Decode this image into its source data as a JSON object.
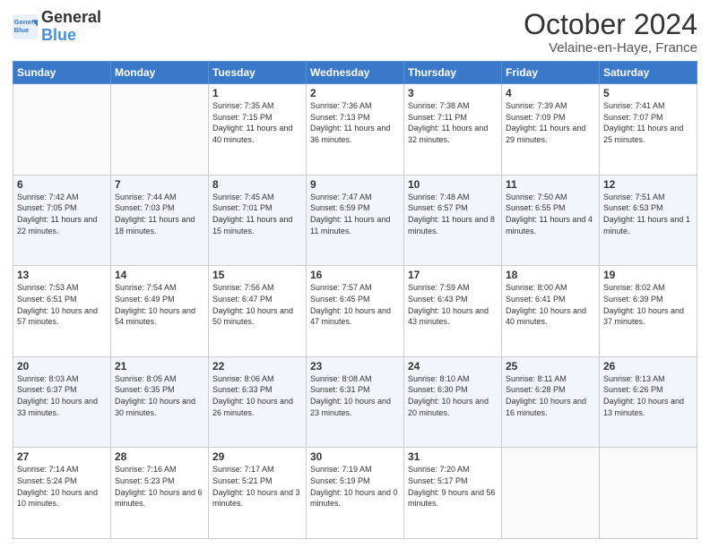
{
  "logo": {
    "line1": "General",
    "line2": "Blue"
  },
  "title": "October 2024",
  "location": "Velaine-en-Haye, France",
  "days_of_week": [
    "Sunday",
    "Monday",
    "Tuesday",
    "Wednesday",
    "Thursday",
    "Friday",
    "Saturday"
  ],
  "weeks": [
    [
      {
        "day": "",
        "info": ""
      },
      {
        "day": "",
        "info": ""
      },
      {
        "day": "1",
        "info": "Sunrise: 7:35 AM\nSunset: 7:15 PM\nDaylight: 11 hours and 40 minutes."
      },
      {
        "day": "2",
        "info": "Sunrise: 7:36 AM\nSunset: 7:13 PM\nDaylight: 11 hours and 36 minutes."
      },
      {
        "day": "3",
        "info": "Sunrise: 7:38 AM\nSunset: 7:11 PM\nDaylight: 11 hours and 32 minutes."
      },
      {
        "day": "4",
        "info": "Sunrise: 7:39 AM\nSunset: 7:09 PM\nDaylight: 11 hours and 29 minutes."
      },
      {
        "day": "5",
        "info": "Sunrise: 7:41 AM\nSunset: 7:07 PM\nDaylight: 11 hours and 25 minutes."
      }
    ],
    [
      {
        "day": "6",
        "info": "Sunrise: 7:42 AM\nSunset: 7:05 PM\nDaylight: 11 hours and 22 minutes."
      },
      {
        "day": "7",
        "info": "Sunrise: 7:44 AM\nSunset: 7:03 PM\nDaylight: 11 hours and 18 minutes."
      },
      {
        "day": "8",
        "info": "Sunrise: 7:45 AM\nSunset: 7:01 PM\nDaylight: 11 hours and 15 minutes."
      },
      {
        "day": "9",
        "info": "Sunrise: 7:47 AM\nSunset: 6:59 PM\nDaylight: 11 hours and 11 minutes."
      },
      {
        "day": "10",
        "info": "Sunrise: 7:48 AM\nSunset: 6:57 PM\nDaylight: 11 hours and 8 minutes."
      },
      {
        "day": "11",
        "info": "Sunrise: 7:50 AM\nSunset: 6:55 PM\nDaylight: 11 hours and 4 minutes."
      },
      {
        "day": "12",
        "info": "Sunrise: 7:51 AM\nSunset: 6:53 PM\nDaylight: 11 hours and 1 minute."
      }
    ],
    [
      {
        "day": "13",
        "info": "Sunrise: 7:53 AM\nSunset: 6:51 PM\nDaylight: 10 hours and 57 minutes."
      },
      {
        "day": "14",
        "info": "Sunrise: 7:54 AM\nSunset: 6:49 PM\nDaylight: 10 hours and 54 minutes."
      },
      {
        "day": "15",
        "info": "Sunrise: 7:56 AM\nSunset: 6:47 PM\nDaylight: 10 hours and 50 minutes."
      },
      {
        "day": "16",
        "info": "Sunrise: 7:57 AM\nSunset: 6:45 PM\nDaylight: 10 hours and 47 minutes."
      },
      {
        "day": "17",
        "info": "Sunrise: 7:59 AM\nSunset: 6:43 PM\nDaylight: 10 hours and 43 minutes."
      },
      {
        "day": "18",
        "info": "Sunrise: 8:00 AM\nSunset: 6:41 PM\nDaylight: 10 hours and 40 minutes."
      },
      {
        "day": "19",
        "info": "Sunrise: 8:02 AM\nSunset: 6:39 PM\nDaylight: 10 hours and 37 minutes."
      }
    ],
    [
      {
        "day": "20",
        "info": "Sunrise: 8:03 AM\nSunset: 6:37 PM\nDaylight: 10 hours and 33 minutes."
      },
      {
        "day": "21",
        "info": "Sunrise: 8:05 AM\nSunset: 6:35 PM\nDaylight: 10 hours and 30 minutes."
      },
      {
        "day": "22",
        "info": "Sunrise: 8:06 AM\nSunset: 6:33 PM\nDaylight: 10 hours and 26 minutes."
      },
      {
        "day": "23",
        "info": "Sunrise: 8:08 AM\nSunset: 6:31 PM\nDaylight: 10 hours and 23 minutes."
      },
      {
        "day": "24",
        "info": "Sunrise: 8:10 AM\nSunset: 6:30 PM\nDaylight: 10 hours and 20 minutes."
      },
      {
        "day": "25",
        "info": "Sunrise: 8:11 AM\nSunset: 6:28 PM\nDaylight: 10 hours and 16 minutes."
      },
      {
        "day": "26",
        "info": "Sunrise: 8:13 AM\nSunset: 6:26 PM\nDaylight: 10 hours and 13 minutes."
      }
    ],
    [
      {
        "day": "27",
        "info": "Sunrise: 7:14 AM\nSunset: 5:24 PM\nDaylight: 10 hours and 10 minutes."
      },
      {
        "day": "28",
        "info": "Sunrise: 7:16 AM\nSunset: 5:23 PM\nDaylight: 10 hours and 6 minutes."
      },
      {
        "day": "29",
        "info": "Sunrise: 7:17 AM\nSunset: 5:21 PM\nDaylight: 10 hours and 3 minutes."
      },
      {
        "day": "30",
        "info": "Sunrise: 7:19 AM\nSunset: 5:19 PM\nDaylight: 10 hours and 0 minutes."
      },
      {
        "day": "31",
        "info": "Sunrise: 7:20 AM\nSunset: 5:17 PM\nDaylight: 9 hours and 56 minutes."
      },
      {
        "day": "",
        "info": ""
      },
      {
        "day": "",
        "info": ""
      }
    ]
  ]
}
